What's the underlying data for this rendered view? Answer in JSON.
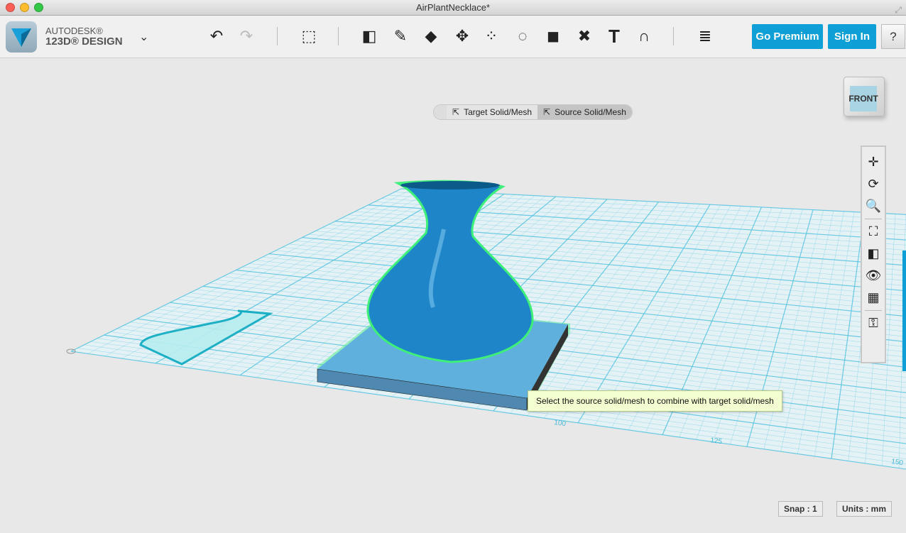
{
  "window": {
    "title": "AirPlantNecklace*"
  },
  "brand": {
    "line1": "AUTODESK®",
    "line2": "123D® DESIGN"
  },
  "toolbar": {
    "tools": [
      {
        "name": "undo-icon",
        "glyph": "↶"
      },
      {
        "name": "redo-icon",
        "glyph": "↷"
      },
      {
        "name": "transform-icon",
        "glyph": "⬚"
      },
      {
        "name": "primitives-icon",
        "glyph": "◧"
      },
      {
        "name": "sketch-icon",
        "glyph": "✎"
      },
      {
        "name": "construct-icon",
        "glyph": "◆"
      },
      {
        "name": "modify-icon",
        "glyph": "✥"
      },
      {
        "name": "pattern-icon",
        "glyph": "⁘"
      },
      {
        "name": "grouping-icon",
        "glyph": "◌"
      },
      {
        "name": "combine-icon",
        "glyph": "◼"
      },
      {
        "name": "measure-icon",
        "glyph": "✖"
      },
      {
        "name": "text-icon",
        "glyph": "T"
      },
      {
        "name": "snap-icon",
        "glyph": "∩"
      },
      {
        "name": "materials-icon",
        "glyph": "≣"
      }
    ],
    "go_premium": "Go Premium",
    "sign_in": "Sign In",
    "help": "?"
  },
  "colors": {
    "accent": "#0d9fd6",
    "grid": "#4cc0e0",
    "solid": "#1e86c8",
    "highlight": "#3ef07a"
  },
  "modebar": {
    "target": "Target Solid/Mesh",
    "source": "Source Solid/Mesh",
    "active": "source"
  },
  "viewcube": {
    "face": "FRONT"
  },
  "nav": [
    {
      "name": "pan-icon",
      "glyph": "✛"
    },
    {
      "name": "orbit-icon",
      "glyph": "⟳"
    },
    {
      "name": "zoom-icon",
      "glyph": "🔍"
    },
    {
      "name": "fit-icon",
      "glyph": "⛶"
    },
    {
      "name": "view-solid-icon",
      "glyph": "◧"
    },
    {
      "name": "visibility-icon",
      "glyph": "👁"
    },
    {
      "name": "view-grid-icon",
      "glyph": "▦"
    },
    {
      "name": "material-lock-icon",
      "glyph": "⚿"
    }
  ],
  "grid_labels": [
    "100",
    "125",
    "150"
  ],
  "tooltip": "Select the source solid/mesh to combine with target solid/mesh",
  "status": {
    "snap": "Snap : 1",
    "units": "Units : mm"
  }
}
